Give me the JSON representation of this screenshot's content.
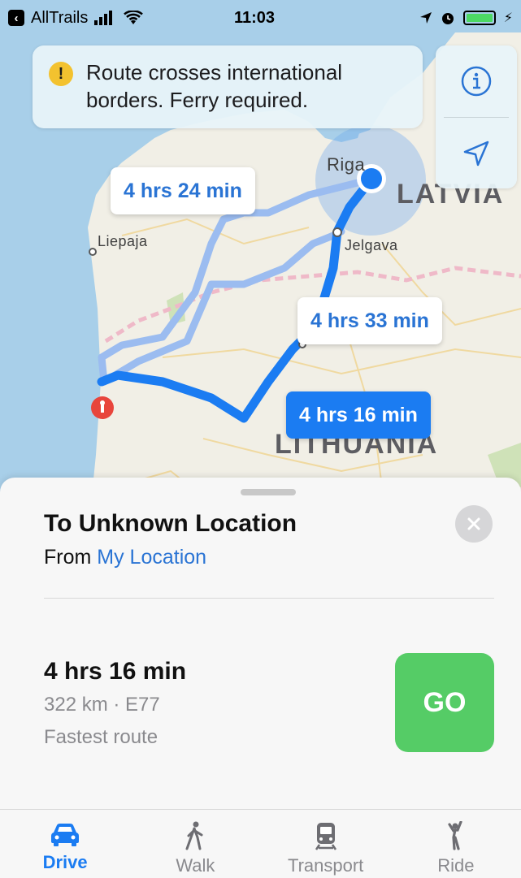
{
  "status_bar": {
    "back_app": "AllTrails",
    "time": "11:03"
  },
  "alert": {
    "icon": "exclamation-icon",
    "message": "Route crosses international borders. Ferry required."
  },
  "map_controls": {
    "info_icon": "info-icon",
    "location_icon": "location-arrow-icon"
  },
  "map": {
    "labels": {
      "riga": "Riga",
      "liepaja": "Liepaja",
      "jelgava": "Jelgava",
      "latvia": "LATVIA",
      "lithuania": "LITHUANIA"
    },
    "routes": [
      {
        "label": "4 hrs 24 min",
        "selected": false
      },
      {
        "label": "4 hrs 33 min",
        "selected": false
      },
      {
        "label": "4 hrs 16 min",
        "selected": true
      }
    ],
    "colors": {
      "route_primary": "#1b7cf2",
      "route_alt": "#9bbcf0",
      "destination_pin": "#e8453c"
    }
  },
  "card": {
    "title": "To Unknown Location",
    "from_prefix": "From",
    "from_link": "My Location",
    "route_time": "4 hrs 16 min",
    "route_details": "322 km · E77",
    "route_note": "Fastest route",
    "go_label": "GO",
    "go_color": "#55cc66"
  },
  "tabs": [
    {
      "label": "Drive",
      "icon": "car-icon",
      "active": true
    },
    {
      "label": "Walk",
      "icon": "walk-icon",
      "active": false
    },
    {
      "label": "Transport",
      "icon": "train-icon",
      "active": false
    },
    {
      "label": "Ride",
      "icon": "hail-icon",
      "active": false
    }
  ]
}
